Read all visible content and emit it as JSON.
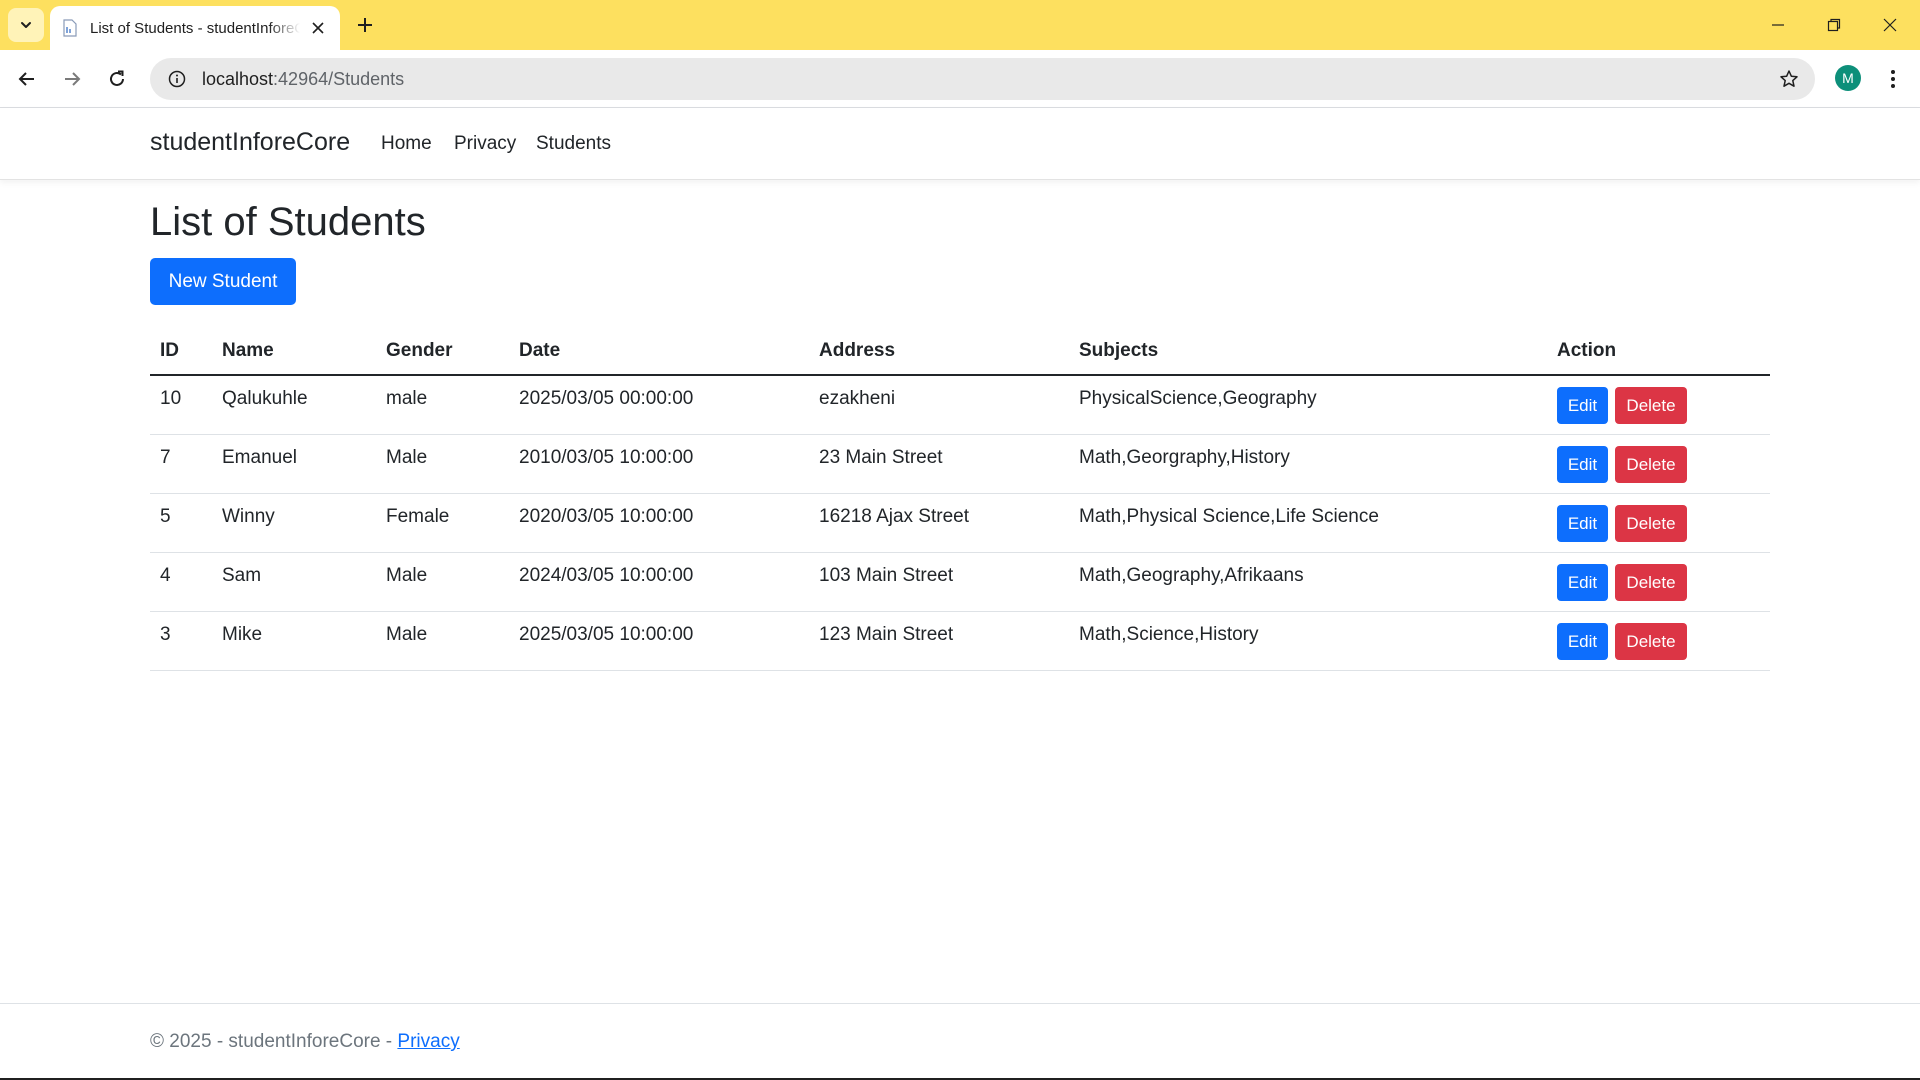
{
  "browser": {
    "tab_title": "List of Students - studentInforeCore",
    "url_host": "localhost",
    "url_path": ":42964/Students",
    "profile_initial": "M",
    "icons": [
      "tab-list-icon",
      "page-favicon-icon",
      "close-icon",
      "plus-icon",
      "minimize-icon",
      "restore-icon",
      "window-close-icon",
      "back-arrow-icon",
      "forward-arrow-icon",
      "reload-icon",
      "site-info-icon",
      "star-icon",
      "kebab-menu-icon"
    ]
  },
  "header": {
    "brand": "studentInforeCore",
    "nav": [
      "Home",
      "Privacy",
      "Students"
    ]
  },
  "main": {
    "title": "List of Students",
    "new_button": "New Student",
    "table": {
      "columns": [
        "ID",
        "Name",
        "Gender",
        "Date",
        "Address",
        "Subjects",
        "Action"
      ],
      "rows": [
        {
          "id": "10",
          "name": "Qalukuhle",
          "gender": "male",
          "date": "2025/03/05 00:00:00",
          "address": "ezakheni",
          "subjects": "PhysicalScience,Geography"
        },
        {
          "id": "7",
          "name": "Emanuel",
          "gender": "Male",
          "date": "2010/03/05 10:00:00",
          "address": "23 Main Street",
          "subjects": "Math,Georgraphy,History"
        },
        {
          "id": "5",
          "name": "Winny",
          "gender": "Female",
          "date": "2020/03/05 10:00:00",
          "address": "16218 Ajax Street",
          "subjects": "Math,Physical Science,Life Science"
        },
        {
          "id": "4",
          "name": "Sam",
          "gender": "Male",
          "date": "2024/03/05 10:00:00",
          "address": "103 Main Street",
          "subjects": "Math,Geography,Afrikaans"
        },
        {
          "id": "3",
          "name": "Mike",
          "gender": "Male",
          "date": "2025/03/05 10:00:00",
          "address": "123 Main Street",
          "subjects": "Math,Science,History"
        }
      ],
      "edit_label": "Edit",
      "delete_label": "Delete"
    }
  },
  "footer": {
    "text": "© 2025 - studentInforeCore - ",
    "link": "Privacy"
  },
  "colors": {
    "tabstrip": "#fde05f",
    "primary": "#0d6efd",
    "danger": "#dc3545",
    "avatar": "#0d8f7a"
  }
}
